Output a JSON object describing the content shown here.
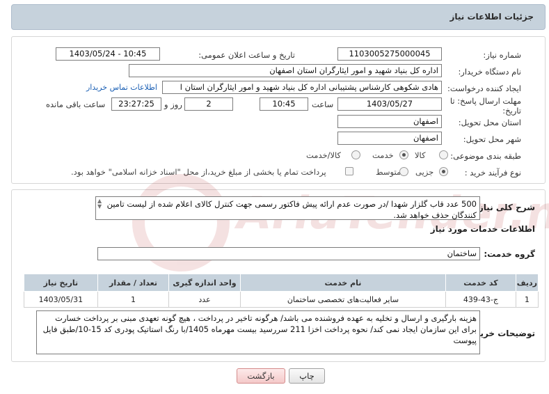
{
  "header": {
    "title": "جزئیات اطلاعات نیاز"
  },
  "fields": {
    "need_number_label": "شماره نیاز:",
    "need_number": "1103005275000045",
    "announce_label": "تاریخ و ساعت اعلان عمومی:",
    "announce_value": "1403/05/24 - 10:45",
    "buyer_label": "نام دستگاه خریدار:",
    "buyer_value": "اداره کل بنیاد شهید و امور ایثارگران استان اصفهان",
    "requester_label": "ایجاد کننده درخواست:",
    "requester_value": "هادی شکوهی کارشناس پشتیبانی اداره کل بنیاد شهید و امور ایثارگران استان ا",
    "contact_link": "اطلاعات تماس خریدار",
    "deadline_label": "مهلت ارسال پاسخ: تا تاریخ:",
    "deadline_date": "1403/05/27",
    "time_label": "ساعت",
    "deadline_time": "10:45",
    "days_value": "2",
    "days_label": "روز و",
    "remaining_value": "23:27:25",
    "remaining_label": "ساعت باقی مانده",
    "province_label": "استان محل تحویل:",
    "province_value": "اصفهان",
    "city_label": "شهر محل تحویل:",
    "city_value": "اصفهان",
    "category_label": "طبقه بندی موضوعی:",
    "category_options": [
      "کالا",
      "خدمت",
      "کالا/خدمت"
    ],
    "process_label": "نوع فرآیند خرید :",
    "process_options": [
      "جزیی",
      "متوسط"
    ],
    "payment_note": "پرداخت تمام یا بخشی از مبلغ خرید،از محل \"اسناد خزانه اسلامی\" خواهد بود."
  },
  "summary": {
    "label": "شرح کلی نیاز:",
    "text": "500 عدد قاب گلزار شهدا /در صورت عدم ارائه پیش فاکتور رسمی جهت کنترل کالای اعلام شده از لیست تامین کنندگان حذف خواهد شد."
  },
  "services": {
    "section_title": "اطلاعات خدمات مورد نیاز",
    "group_label": "گروه خدمت:",
    "group_value": "ساختمان",
    "columns": [
      "ردیف",
      "کد خدمت",
      "نام خدمت",
      "واحد اندازه گیری",
      "تعداد / مقدار",
      "تاریخ نیاز"
    ],
    "rows": [
      [
        "1",
        "ج-43-439",
        "سایر فعالیت‌های تخصصی ساختمان",
        "عدد",
        "1",
        "1403/05/31"
      ]
    ]
  },
  "buyer_notes": {
    "label": "توضیحات خریدار:",
    "text": "هزینه بارگیری و ارسال و تخلیه به عهده فروشنده می باشد/ هرگونه تاخیر در پرداخت ، هیچ گونه تعهدی مبنی بر پرداخت خسارت برای این سازمان ایجاد نمی کند/ نحوه پرداخت اخزا 211 سررسید بیست مهرماه 1405/با رنگ استاتیک پودری کد 15-10/طبق فایل پیوست"
  },
  "buttons": {
    "print": "چاپ",
    "back": "بازگشت"
  },
  "watermark": {
    "text": "AriaTender.neT"
  },
  "colors": {
    "header_bg": "#c6d2dc",
    "link": "#1a5fb4",
    "back_button": "#f4c9c9"
  }
}
